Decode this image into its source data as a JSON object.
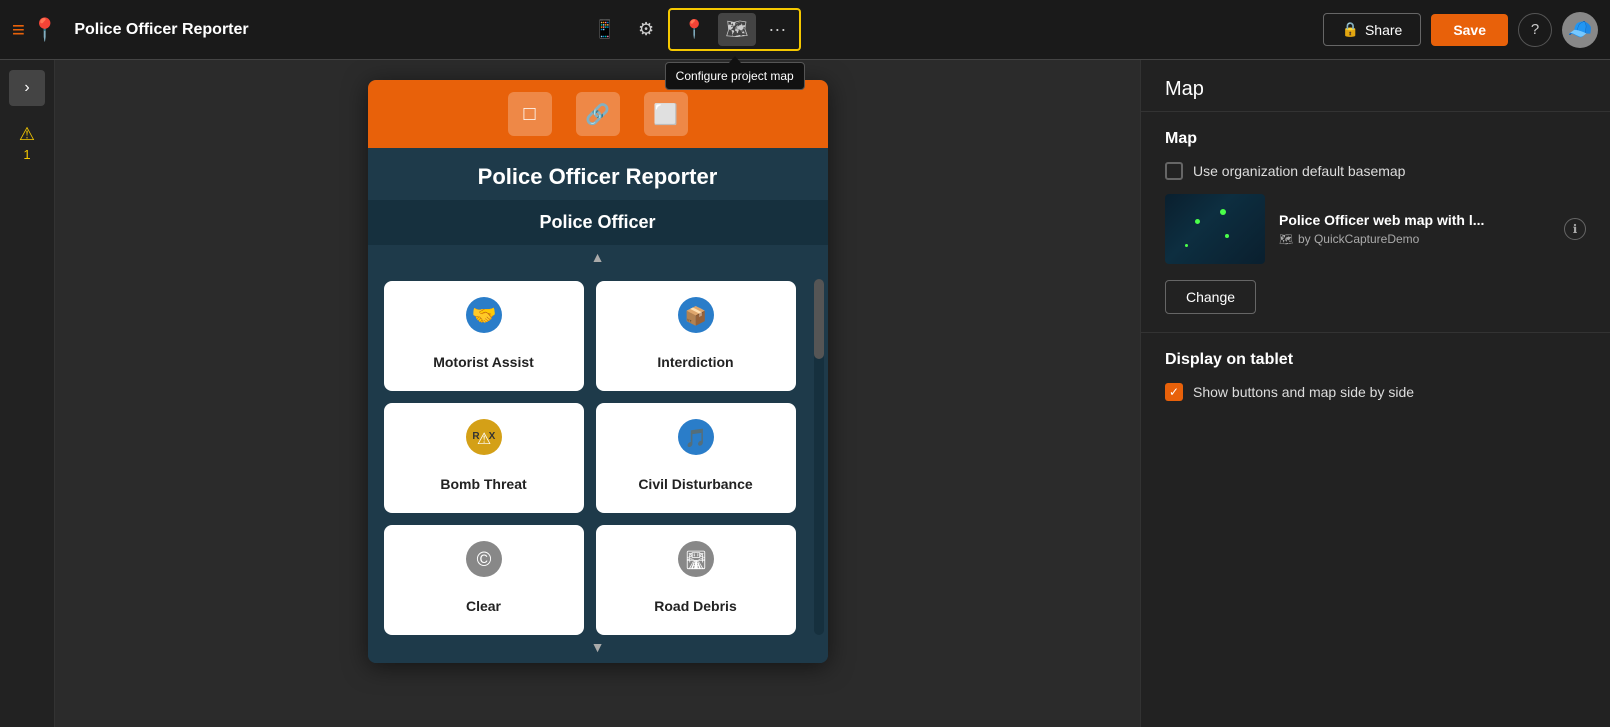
{
  "topbar": {
    "logo_icon": "≡📍",
    "title": "Police Officer Reporter",
    "mobile_icon": "📱",
    "settings_icon": "⚙",
    "toolbar_icons": [
      "📍",
      "🗺"
    ],
    "more_icon": "···",
    "tooltip": "Configure project map",
    "share_label": "Share",
    "save_label": "Save",
    "help_icon": "?",
    "avatar_icon": "🧢"
  },
  "sidebar": {
    "toggle_icon": ">",
    "warning_icon": "⚠",
    "warning_count": "1"
  },
  "preview": {
    "title": "Police Officer Reporter",
    "page_title": "Police Officer",
    "toolbar_buttons": [
      "□",
      "🔗",
      "⬜"
    ],
    "grid_cards": [
      {
        "id": "motorist-assist",
        "label": "Motorist Assist",
        "icon": "🤝",
        "icon_color": "#2a7dc9"
      },
      {
        "id": "interdiction",
        "label": "Interdiction",
        "icon": "📦",
        "icon_color": "#2a7dc9"
      },
      {
        "id": "bomb-threat",
        "label": "Bomb Threat",
        "icon": "⚠",
        "icon_color": "#d4a017"
      },
      {
        "id": "civil-disturbance",
        "label": "Civil Disturbance",
        "icon": "🎵",
        "icon_color": "#2a7dc9"
      },
      {
        "id": "clear",
        "label": "Clear",
        "icon": "©",
        "icon_color": "#888"
      },
      {
        "id": "road-debris",
        "label": "Road Debris",
        "icon": "🛣",
        "icon_color": "#888"
      }
    ]
  },
  "right_panel": {
    "section_title": "Map",
    "map_section_title": "Map",
    "checkbox_label": "Use organization default basemap",
    "map_title": "Police Officer web map with l...",
    "map_subtitle": "by QuickCaptureDemo",
    "change_label": "Change",
    "tablet_section_title": "Display on tablet",
    "tablet_checkbox_label": "Show buttons and map side by side"
  }
}
